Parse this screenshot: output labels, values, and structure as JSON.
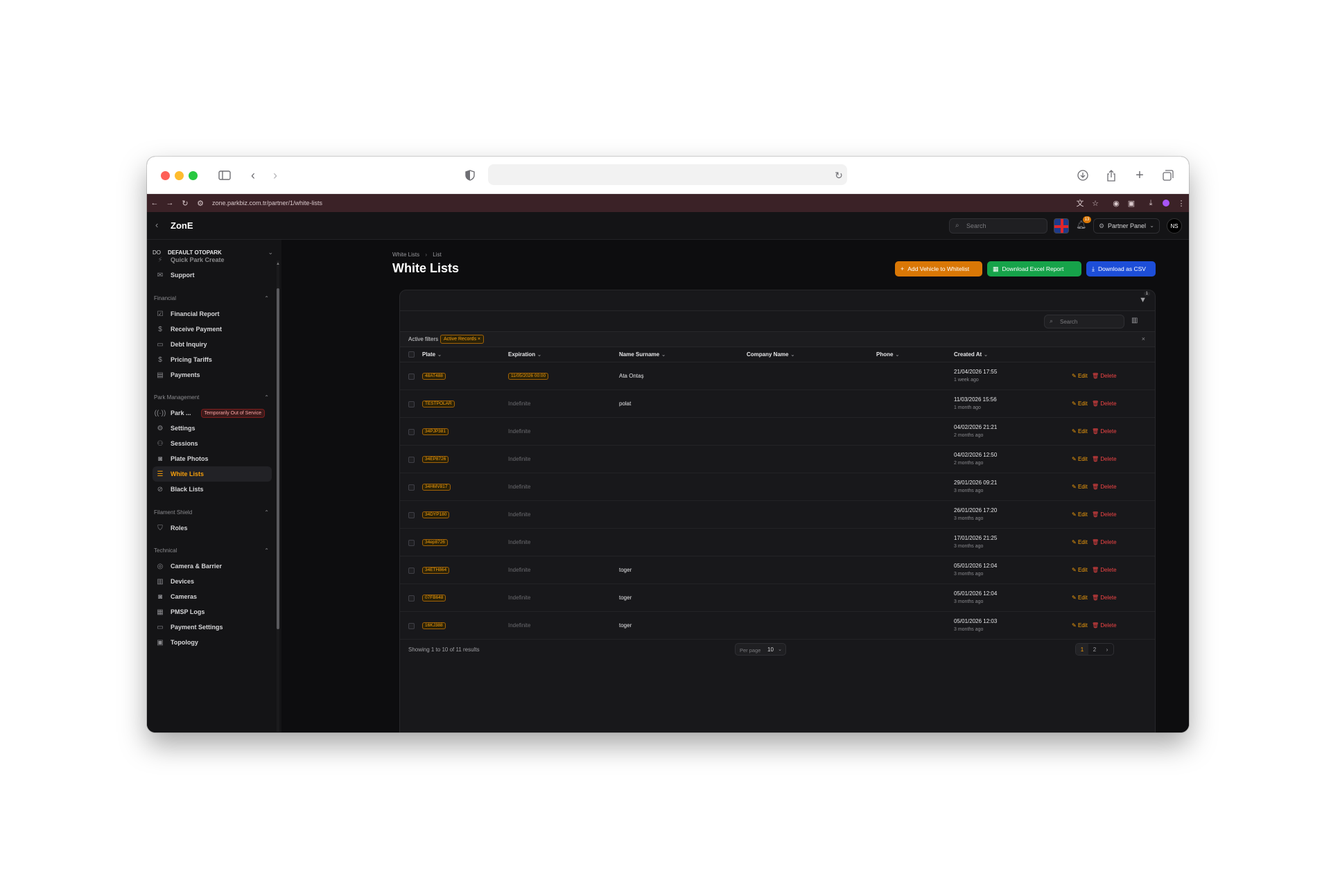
{
  "browser": {
    "url": "zone.parkbiz.com.tr/partner/1/white-lists"
  },
  "header": {
    "brand": "ZonE",
    "search_placeholder": "Search",
    "notification_count": "13",
    "partner_label": "Partner Panel",
    "avatar_initials": "NS"
  },
  "sidebar": {
    "tenant_abbr": "DO",
    "tenant_name": "DEFAULT OTOPARK",
    "partial_top_item": "Quick Park Create",
    "support": "Support",
    "groups": {
      "financial": "Financial",
      "park_management": "Park Management",
      "filament_shield": "Filament Shield",
      "technical": "Technical"
    },
    "items": {
      "financial_report": "Financial Report",
      "receive_payment": "Receive Payment",
      "debt_inquiry": "Debt Inquiry",
      "pricing_tariffs": "Pricing Tariffs",
      "payments": "Payments",
      "park": "Park ...",
      "park_badge": "Temporarily Out of Service",
      "settings": "Settings",
      "sessions": "Sessions",
      "plate_photos": "Plate Photos",
      "white_lists": "White Lists",
      "black_lists": "Black Lists",
      "roles": "Roles",
      "camera_barrier": "Camera & Barrier",
      "devices": "Devices",
      "cameras": "Cameras",
      "pmsp_logs": "PMSP Logs",
      "payment_settings": "Payment Settings",
      "topology": "Topology"
    }
  },
  "page": {
    "breadcrumb_root": "White Lists",
    "breadcrumb_current": "List",
    "title": "White Lists",
    "actions": {
      "add": "Add Vehicle to Whitelist",
      "excel": "Download Excel Report",
      "csv": "Download as CSV"
    }
  },
  "table": {
    "filter_count": "1",
    "search_placeholder": "Search",
    "active_filters_label": "Active filters",
    "active_filter_chip": "Active Records",
    "columns": {
      "plate": "Plate",
      "expiration": "Expiration",
      "name": "Name Surname",
      "company": "Company Name",
      "phone": "Phone",
      "created": "Created At"
    },
    "edit_label": "Edit",
    "delete_label": "Delete",
    "rows": [
      {
        "plate": "48AT488",
        "expiration": "11/05/2026 00:00",
        "name": "Ata Ontaş",
        "created": "21/04/2026 17:55",
        "relative": "1 week ago"
      },
      {
        "plate": "TESTPOLAR",
        "expiration": "Indefinite",
        "name": "polat",
        "created": "11/03/2026 15:56",
        "relative": "1 month ago"
      },
      {
        "plate": "34PJP381",
        "expiration": "Indefinite",
        "name": "",
        "created": "04/02/2026 21:21",
        "relative": "2 months ago"
      },
      {
        "plate": "34EP8726",
        "expiration": "Indefinite",
        "name": "",
        "created": "04/02/2026 12:50",
        "relative": "2 months ago"
      },
      {
        "plate": "34HMV817",
        "expiration": "Indefinite",
        "name": "",
        "created": "29/01/2026 09:21",
        "relative": "3 months ago"
      },
      {
        "plate": "34DYP180",
        "expiration": "Indefinite",
        "name": "",
        "created": "26/01/2026 17:20",
        "relative": "3 months ago"
      },
      {
        "plate": "34ep8726",
        "expiration": "Indefinite",
        "name": "",
        "created": "17/01/2026 21:25",
        "relative": "3 months ago"
      },
      {
        "plate": "34ETH864",
        "expiration": "Indefinite",
        "name": "toger",
        "created": "05/01/2026 12:04",
        "relative": "3 months ago"
      },
      {
        "plate": "07FB648",
        "expiration": "Indefinite",
        "name": "toger",
        "created": "05/01/2026 12:04",
        "relative": "3 months ago"
      },
      {
        "plate": "16KJ388",
        "expiration": "Indefinite",
        "name": "toger",
        "created": "05/01/2026 12:03",
        "relative": "3 months ago"
      }
    ],
    "showing_text": "Showing 1 to 10 of 11 results",
    "per_page_label": "Per page",
    "per_page_value": "10",
    "pages": [
      "1",
      "2"
    ],
    "next_glyph": "›"
  },
  "colors": {
    "accent": "#f59e0b",
    "danger": "#ef4444",
    "add_button": "#d97706",
    "excel_button": "#16a34a",
    "csv_button": "#1d4ed8"
  }
}
